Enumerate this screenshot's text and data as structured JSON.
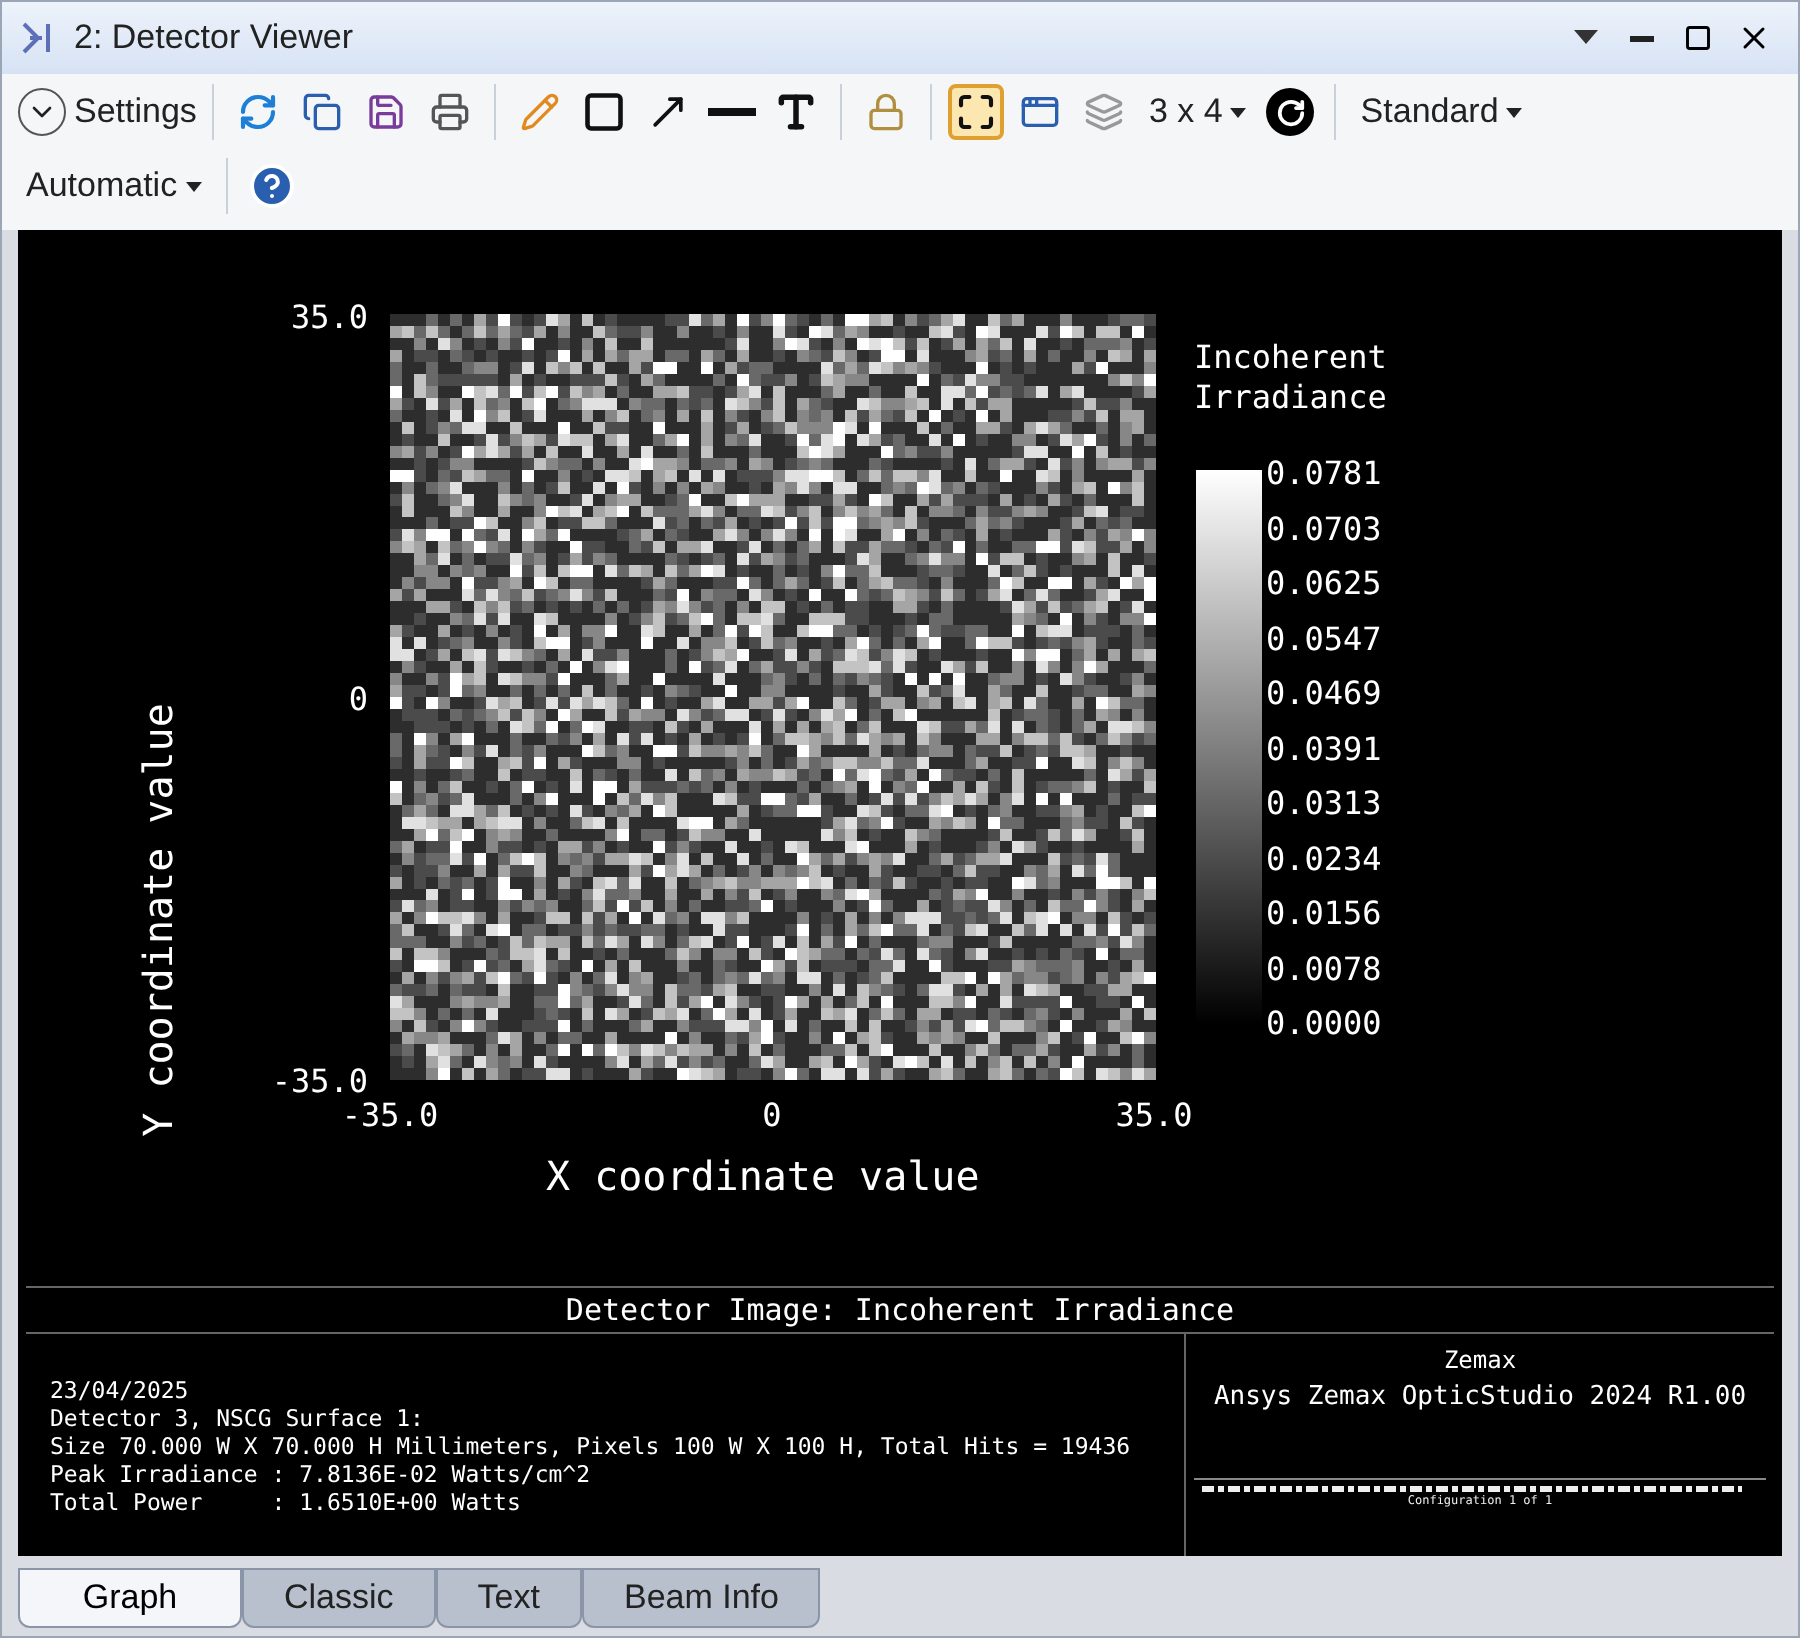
{
  "window": {
    "title": "2: Detector Viewer"
  },
  "toolbar": {
    "settings": "Settings",
    "layout": "3 x 4",
    "style": "Standard",
    "scale": "Automatic",
    "grid_toggle_on": true
  },
  "plot": {
    "y_label": "Y coordinate value",
    "x_label": "X coordinate value",
    "y_ticks": [
      "35.0",
      "0",
      "-35.0"
    ],
    "x_ticks": [
      "-35.0",
      "0",
      "35.0"
    ],
    "legend_title": "Incoherent Irradiance",
    "legend_ticks": [
      "0.0781",
      "0.0703",
      "0.0625",
      "0.0547",
      "0.0469",
      "0.0391",
      "0.0313",
      "0.0234",
      "0.0156",
      "0.0078",
      "0.0000"
    ]
  },
  "info": {
    "title": "Detector Image: Incoherent Irradiance",
    "lines": [
      "23/04/2025",
      "Detector 3, NSCG Surface 1:",
      "Size 70.000 W X 70.000 H Millimeters, Pixels 100 W X 100 H, Total Hits = 19436",
      "Peak Irradiance : 7.8136E-02 Watts/cm^2",
      "Total Power     : 1.6510E+00 Watts"
    ],
    "company": "Zemax",
    "product": "Ansys Zemax OpticStudio 2024 R1.00",
    "configuration": "Configuration 1 of 1"
  },
  "tabs": [
    {
      "label": "Graph",
      "selected": true
    },
    {
      "label": "Classic",
      "selected": false
    },
    {
      "label": "Text",
      "selected": false
    },
    {
      "label": "Beam Info",
      "selected": false
    }
  ]
}
